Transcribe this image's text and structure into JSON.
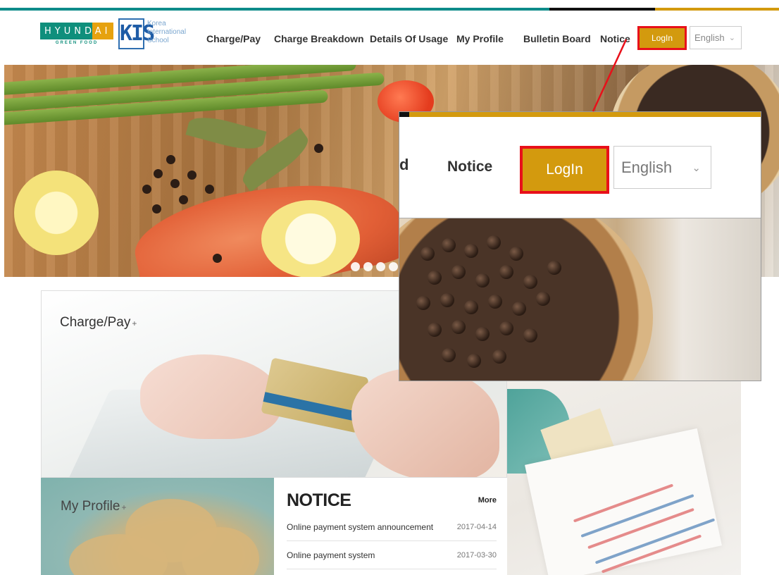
{
  "brand": {
    "hyundai_word": "HYUNDAI",
    "hyundai_sub": "GREEN FOOD",
    "kis_mark": "KIS",
    "kis_text_lines": [
      "Korea",
      "International",
      "School"
    ]
  },
  "nav": {
    "items": [
      {
        "label": "Charge/Pay"
      },
      {
        "label": "Charge Breakdown"
      },
      {
        "label": "Details Of Usage"
      },
      {
        "label": "My Profile"
      },
      {
        "label": "Bulletin Board"
      },
      {
        "label": "Notice"
      }
    ],
    "login_label": "LogIn",
    "language": "English"
  },
  "zoom": {
    "fragment": "d",
    "notice_label": "Notice",
    "login_label": "LogIn",
    "language": "English"
  },
  "cards": {
    "charge_pay": "Charge/Pay",
    "my_profile": "My Profile",
    "plus_glyph": "+"
  },
  "notice": {
    "title": "NOTICE",
    "more": "More",
    "items": [
      {
        "title": "Online payment system announcement",
        "date": "2017-04-14"
      },
      {
        "title": "Online payment system",
        "date": "2017-03-30"
      }
    ]
  },
  "colors": {
    "teal": "#0e8c8a",
    "gold": "#d39a0e",
    "highlight_red": "#e8101a"
  }
}
